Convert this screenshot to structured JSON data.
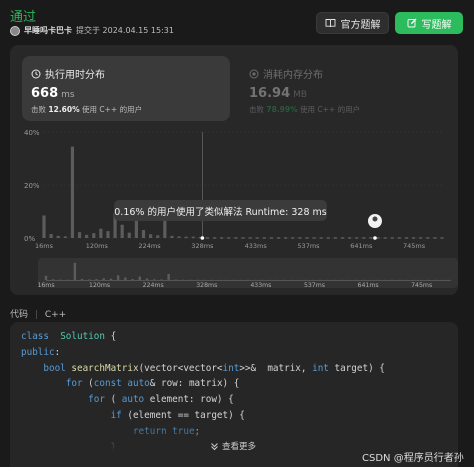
{
  "submission": {
    "status": "通过",
    "author": "早睡吗卡巴卡",
    "submitted_text": "提交于 2024.04.15 15:31"
  },
  "buttons": {
    "official": "官方题解",
    "write": "写题解"
  },
  "runtime": {
    "title": "执行用时分布",
    "value": "668",
    "unit": "ms",
    "beat_prefix": "击败",
    "beat_pct": "12.60%",
    "beat_suffix": "使用 C++ 的用户"
  },
  "memory": {
    "title": "消耗内存分布",
    "value": "16.94",
    "unit": "MB",
    "beat_prefix": "击败",
    "beat_pct": "78.99%",
    "beat_suffix": "使用 C++ 的用户"
  },
  "tooltip": "0.16% 的用户使用了类似解法 Runtime: 328 ms",
  "chart_data": {
    "type": "bar",
    "y_ticks": [
      "40%",
      "20%",
      "0%"
    ],
    "ylim": [
      0,
      40
    ],
    "x_ticks": [
      "16ms",
      "120ms",
      "224ms",
      "328ms",
      "433ms",
      "537ms",
      "641ms",
      "745ms"
    ],
    "x_range": [
      16,
      800
    ],
    "highlight_x": 328,
    "user_x": 668,
    "bars": [
      {
        "x": 16,
        "y": 8.5
      },
      {
        "x": 30,
        "y": 1.5
      },
      {
        "x": 44,
        "y": 0.8
      },
      {
        "x": 58,
        "y": 0.6
      },
      {
        "x": 72,
        "y": 34.5
      },
      {
        "x": 86,
        "y": 2.2
      },
      {
        "x": 100,
        "y": 1.2
      },
      {
        "x": 114,
        "y": 1.8
      },
      {
        "x": 128,
        "y": 3.5
      },
      {
        "x": 142,
        "y": 2.6
      },
      {
        "x": 156,
        "y": 9.5
      },
      {
        "x": 170,
        "y": 5.0
      },
      {
        "x": 184,
        "y": 2.0
      },
      {
        "x": 198,
        "y": 7.0
      },
      {
        "x": 212,
        "y": 3.0
      },
      {
        "x": 226,
        "y": 1.4
      },
      {
        "x": 240,
        "y": 1.0
      },
      {
        "x": 254,
        "y": 12.0
      },
      {
        "x": 268,
        "y": 0.8
      },
      {
        "x": 282,
        "y": 0.6
      },
      {
        "x": 296,
        "y": 0.5
      },
      {
        "x": 310,
        "y": 0.5
      },
      {
        "x": 324,
        "y": 0.4
      }
    ],
    "baseline_from": 338,
    "baseline_step": 14,
    "baseline_value": 0.3
  },
  "code": {
    "label": "代码",
    "language": "C++",
    "lines": [
      [
        [
          "kw",
          "class"
        ],
        [
          "",
          "  "
        ],
        [
          "ty",
          "Solution"
        ],
        [
          "",
          " {"
        ]
      ],
      [
        [
          "kw",
          "public"
        ],
        [
          "",
          ":"
        ]
      ],
      [
        [
          "",
          "    "
        ],
        [
          "kw",
          "bool"
        ],
        [
          "",
          " "
        ],
        [
          "fn",
          "searchMatrix"
        ],
        [
          "",
          "(vector<vector<"
        ],
        [
          "kw",
          "int"
        ],
        [
          "",
          ">>&  matrix, "
        ],
        [
          "kw",
          "int"
        ],
        [
          "",
          " target) {"
        ]
      ],
      [
        [
          "",
          "        "
        ],
        [
          "kw",
          "for"
        ],
        [
          "",
          " ("
        ],
        [
          "kw",
          "const"
        ],
        [
          "",
          " "
        ],
        [
          "kw",
          "auto"
        ],
        [
          "",
          "& row: matrix) {"
        ]
      ],
      [
        [
          "",
          "            "
        ],
        [
          "kw",
          "for"
        ],
        [
          "",
          " ( "
        ],
        [
          "kw",
          "auto"
        ],
        [
          "",
          " element: row) {"
        ]
      ],
      [
        [
          "",
          "                "
        ],
        [
          "kw",
          "if"
        ],
        [
          "",
          " (element == target) {"
        ]
      ],
      [
        [
          "",
          "                    "
        ],
        [
          "kw",
          "return"
        ],
        [
          "",
          " "
        ],
        [
          "kw",
          "true"
        ],
        [
          "",
          ";"
        ]
      ],
      [
        [
          "",
          "                }"
        ]
      ]
    ],
    "more": "查看更多"
  },
  "watermark": "CSDN @程序员行者孙"
}
